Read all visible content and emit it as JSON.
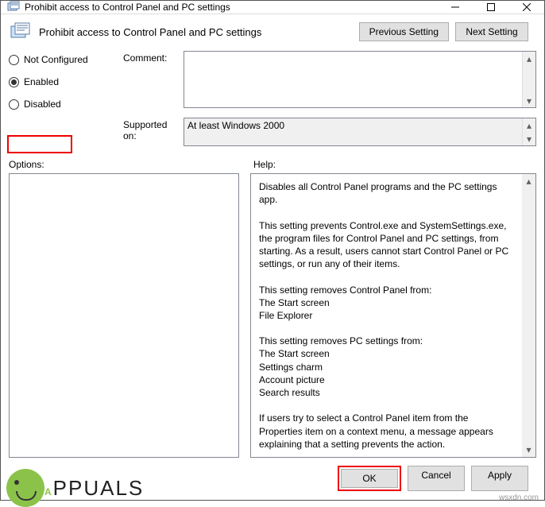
{
  "titlebar": {
    "title": "Prohibit access to Control Panel and PC settings"
  },
  "header": {
    "name": "Prohibit access to Control Panel and PC settings",
    "prev": "Previous Setting",
    "next": "Next Setting"
  },
  "radios": {
    "not_configured": "Not Configured",
    "enabled": "Enabled",
    "disabled": "Disabled",
    "selected": "enabled"
  },
  "labels": {
    "comment": "Comment:",
    "supported": "Supported on:",
    "options": "Options:",
    "help": "Help:"
  },
  "fields": {
    "comment": "",
    "supported": "At least Windows 2000"
  },
  "help_text": "Disables all Control Panel programs and the PC settings app.\n\nThis setting prevents Control.exe and SystemSettings.exe, the program files for Control Panel and PC settings, from starting. As a result, users cannot start Control Panel or PC settings, or run any of their items.\n\nThis setting removes Control Panel from:\nThe Start screen\nFile Explorer\n\nThis setting removes PC settings from:\nThe Start screen\nSettings charm\nAccount picture\nSearch results\n\nIf users try to select a Control Panel item from the Properties item on a context menu, a message appears explaining that a setting prevents the action.",
  "options_text": "",
  "footer": {
    "ok": "OK",
    "cancel": "Cancel",
    "apply": "Apply"
  },
  "attrib": "wsxdn.com"
}
